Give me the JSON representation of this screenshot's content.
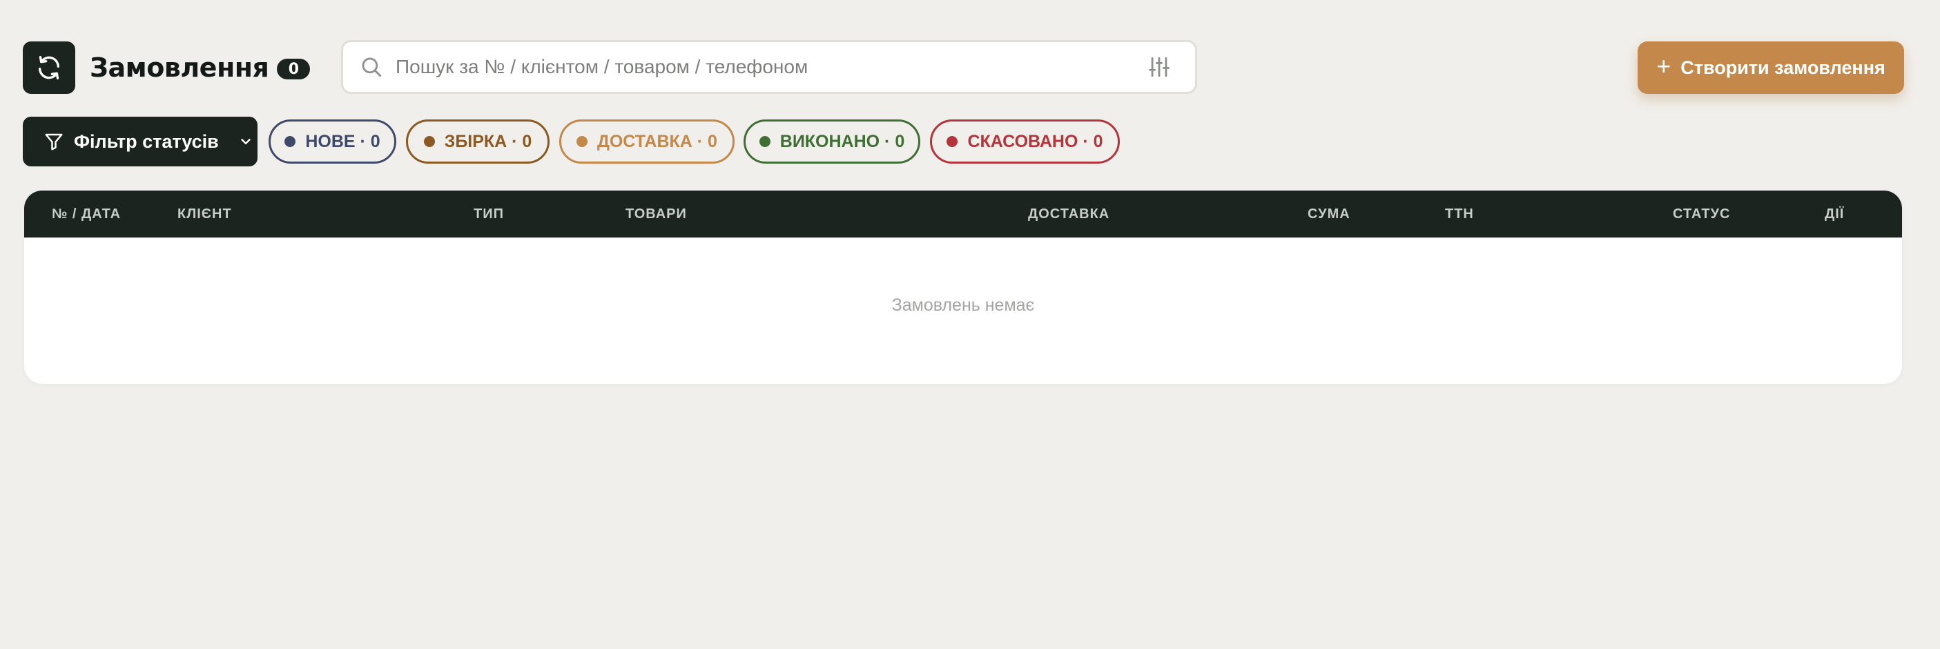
{
  "header": {
    "title": "Замовлення",
    "count": "0",
    "refresh_icon": "refresh-icon"
  },
  "search": {
    "value": "",
    "placeholder": "Пошук за № / клієнтом / товаром / телефоном",
    "icon": "search-icon",
    "settings_icon": "sliders-icon"
  },
  "create_button": {
    "label": "Створити замовлення",
    "icon": "plus-icon",
    "color": "#c3884a"
  },
  "status_filter": {
    "label": "Фільтр статусів",
    "icon": "funnel-icon"
  },
  "status_pills": [
    {
      "label": "НОВЕ · 0",
      "color": "#3f4a6b"
    },
    {
      "label": "ЗБІРКА · 0",
      "color": "#8a5a22"
    },
    {
      "label": "ДОСТАВКА · 0",
      "color": "#c3884a"
    },
    {
      "label": "ВИКОНАНО · 0",
      "color": "#3f6f34"
    },
    {
      "label": "СКАСОВАНО · 0",
      "color": "#b3343a"
    }
  ],
  "table": {
    "columns": [
      "№ / ДАТА",
      "КЛІЄНТ",
      "ТИП",
      "ТОВАРИ",
      "ДОСТАВКА",
      "СУМА",
      "ТТН",
      "СТАТУС",
      "ДІЇ"
    ],
    "empty_text": "Замовлень немає"
  },
  "colors": {
    "background": "#f1efeb",
    "dark": "#1b241f",
    "accent": "#c3884a"
  }
}
